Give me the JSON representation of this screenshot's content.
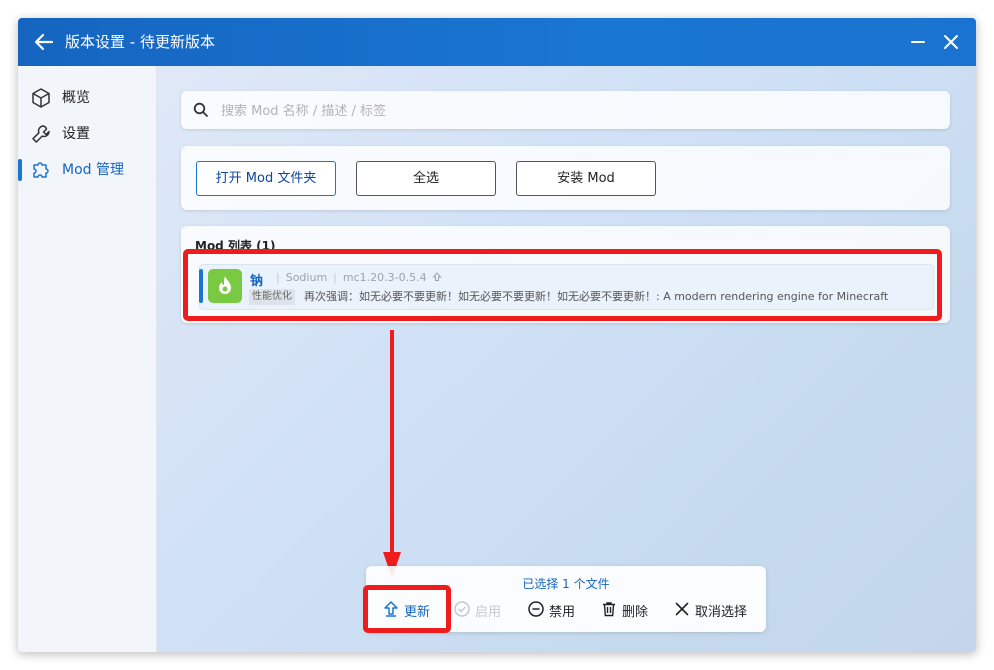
{
  "window": {
    "title": "版本设置 - 待更新版本"
  },
  "sidebar": {
    "items": [
      {
        "label": "概览",
        "icon": "cube-icon"
      },
      {
        "label": "设置",
        "icon": "wrench-icon"
      },
      {
        "label": "Mod 管理",
        "icon": "puzzle-icon",
        "active": true
      }
    ]
  },
  "search": {
    "placeholder": "搜索 Mod 名称 / 描述 / 标签",
    "value": ""
  },
  "toolbar": {
    "open_folder": "打开 Mod 文件夹",
    "select_all": "全选",
    "install_mod": "安装 Mod"
  },
  "mod_list": {
    "title": "Mod 列表 (1)",
    "items": [
      {
        "name": "钠",
        "en_name": "Sodium",
        "version": "mc1.20.3-0.5.4",
        "tag": "性能优化",
        "description": "再次强调：如无必要不要更新！如无必要不要更新！如无必要不要更新！: A modern rendering engine for Minecraft",
        "icon": "flame-icon",
        "selected": true,
        "update_available": true
      }
    ]
  },
  "actions": {
    "selected_count": "已选择 1 个文件",
    "update": "更新",
    "enable": "启用",
    "disable": "禁用",
    "delete": "删除",
    "cancel_select": "取消选择"
  },
  "colors": {
    "accent": "#1976d2",
    "titlebar": "#1565c0",
    "highlight": "#ee1c1c",
    "mod_icon_bg": "#7ac943"
  }
}
